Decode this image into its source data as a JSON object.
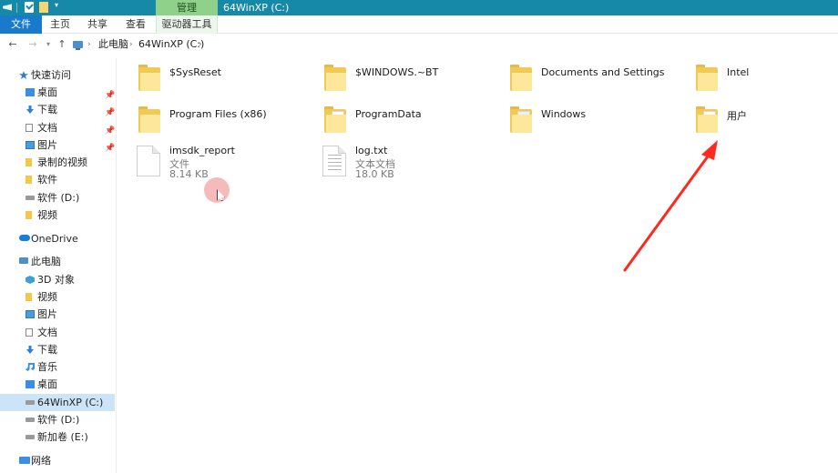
{
  "titlebar": {
    "context_tab": "管理",
    "window_title": "64WinXP   (C:)"
  },
  "ribbon": {
    "tabs": [
      "文件",
      "主页",
      "共享",
      "查看",
      "驱动器工具"
    ]
  },
  "address": {
    "crumbs": [
      "此电脑",
      "64WinXP   (C:)"
    ]
  },
  "navpane": {
    "items": [
      {
        "label": "快速访问",
        "icon": "star-icon",
        "level": "top",
        "pinned": false
      },
      {
        "label": "桌面",
        "icon": "desktop-icon",
        "level": "child",
        "pinned": true
      },
      {
        "label": "下载",
        "icon": "download-icon",
        "level": "child",
        "pinned": true
      },
      {
        "label": "文档",
        "icon": "document-icon",
        "level": "child",
        "pinned": true
      },
      {
        "label": "图片",
        "icon": "picture-icon",
        "level": "child",
        "pinned": true
      },
      {
        "label": "录制的视频",
        "icon": "folder-icon",
        "level": "child",
        "pinned": false
      },
      {
        "label": "软件",
        "icon": "folder-icon",
        "level": "child",
        "pinned": false
      },
      {
        "label": "软件 (D:)",
        "icon": "drive-icon",
        "level": "child",
        "pinned": false
      },
      {
        "label": "视频",
        "icon": "folder-icon",
        "level": "child",
        "pinned": false
      },
      {
        "label": "OneDrive",
        "icon": "cloud-icon",
        "level": "top",
        "pinned": false
      },
      {
        "label": "此电脑",
        "icon": "computer-icon",
        "level": "top",
        "pinned": false
      },
      {
        "label": "3D 对象",
        "icon": "3d-objects-icon",
        "level": "child",
        "pinned": false
      },
      {
        "label": "视频",
        "icon": "video-icon",
        "level": "child",
        "pinned": false
      },
      {
        "label": "图片",
        "icon": "picture-icon",
        "level": "child",
        "pinned": false
      },
      {
        "label": "文档",
        "icon": "document-icon",
        "level": "child",
        "pinned": false
      },
      {
        "label": "下载",
        "icon": "download-icon",
        "level": "child",
        "pinned": false
      },
      {
        "label": "音乐",
        "icon": "music-icon",
        "level": "child",
        "pinned": false
      },
      {
        "label": "桌面",
        "icon": "desktop-icon",
        "level": "child",
        "pinned": false
      },
      {
        "label": "64WinXP   (C:)",
        "icon": "drive-icon",
        "level": "child",
        "pinned": false,
        "selected": true
      },
      {
        "label": "软件 (D:)",
        "icon": "drive-icon",
        "level": "child",
        "pinned": false
      },
      {
        "label": "新加卷 (E:)",
        "icon": "drive-icon",
        "level": "child",
        "pinned": false
      },
      {
        "label": "网络",
        "icon": "network-icon",
        "level": "top",
        "pinned": false
      }
    ]
  },
  "content": {
    "folders": [
      {
        "name": "$SysReset",
        "icon": "folder-icon"
      },
      {
        "name": "$WINDOWS.~BT",
        "icon": "folder-icon"
      },
      {
        "name": "Documents and Settings",
        "icon": "folder-shortcut-icon"
      },
      {
        "name": "Intel",
        "icon": "folder-icon"
      },
      {
        "name": "Program Files (x86)",
        "icon": "folder-icon"
      },
      {
        "name": "ProgramData",
        "icon": "folder-icon"
      },
      {
        "name": "Windows",
        "icon": "system-folder-icon"
      },
      {
        "name": "用户",
        "icon": "users-folder-icon"
      }
    ],
    "files": [
      {
        "name": "imsdk_report",
        "type": "文件",
        "size": "8.14 KB",
        "icon": "blank-file-icon"
      },
      {
        "name": "log.txt",
        "type": "文本文档",
        "size": "18.0 KB",
        "icon": "text-file-icon"
      }
    ]
  },
  "annotation": {
    "color": "#ff2a1f",
    "points_to": "用户"
  }
}
